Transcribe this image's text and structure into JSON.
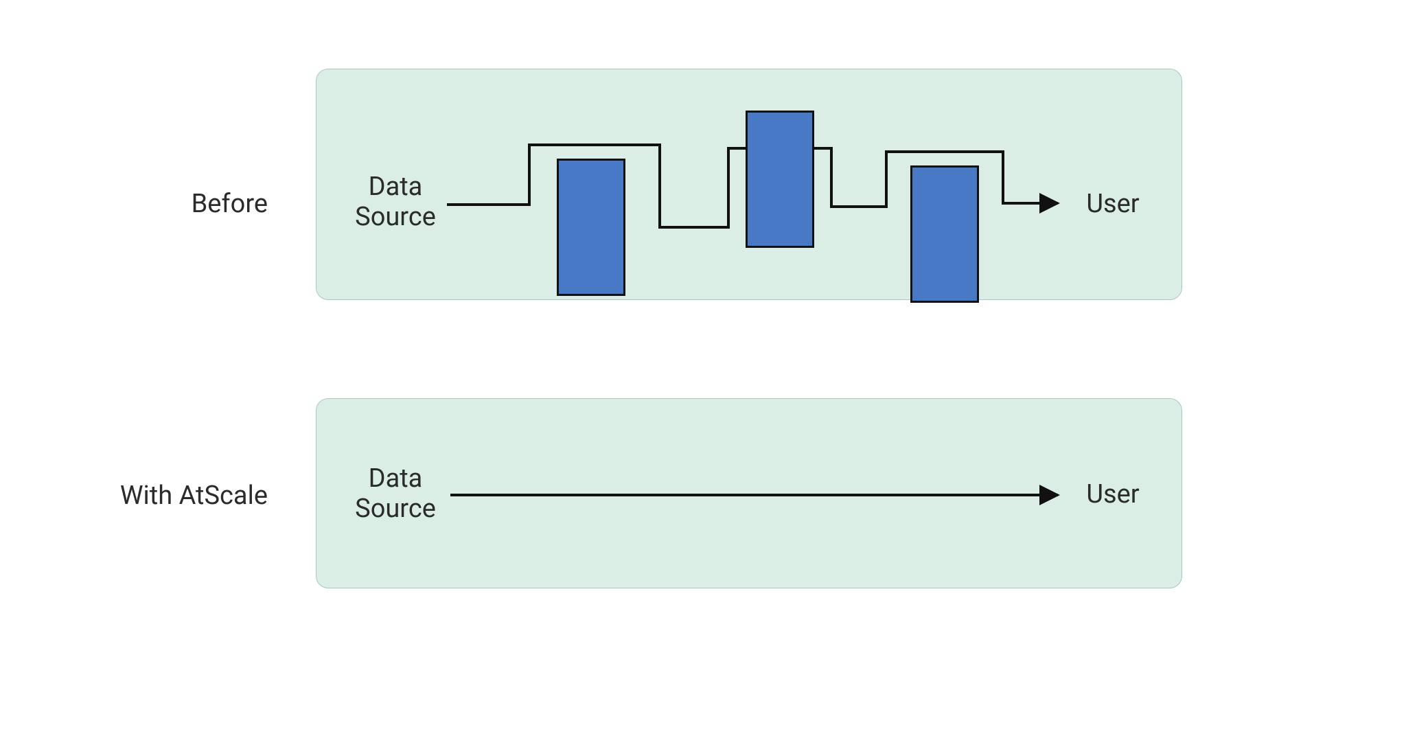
{
  "rows": {
    "before": {
      "label": "Before",
      "source": "Data\nSource",
      "user": "User"
    },
    "withAtScale": {
      "label": "With AtScale",
      "source": "Data\nSource",
      "user": "User"
    }
  },
  "colors": {
    "panelBg": "#dbeee6",
    "panelBorder": "#a9c9bf",
    "blockFill": "#4879c6",
    "blockStroke": "#111111",
    "lineStroke": "#111111",
    "text": "#2b2b2b"
  }
}
